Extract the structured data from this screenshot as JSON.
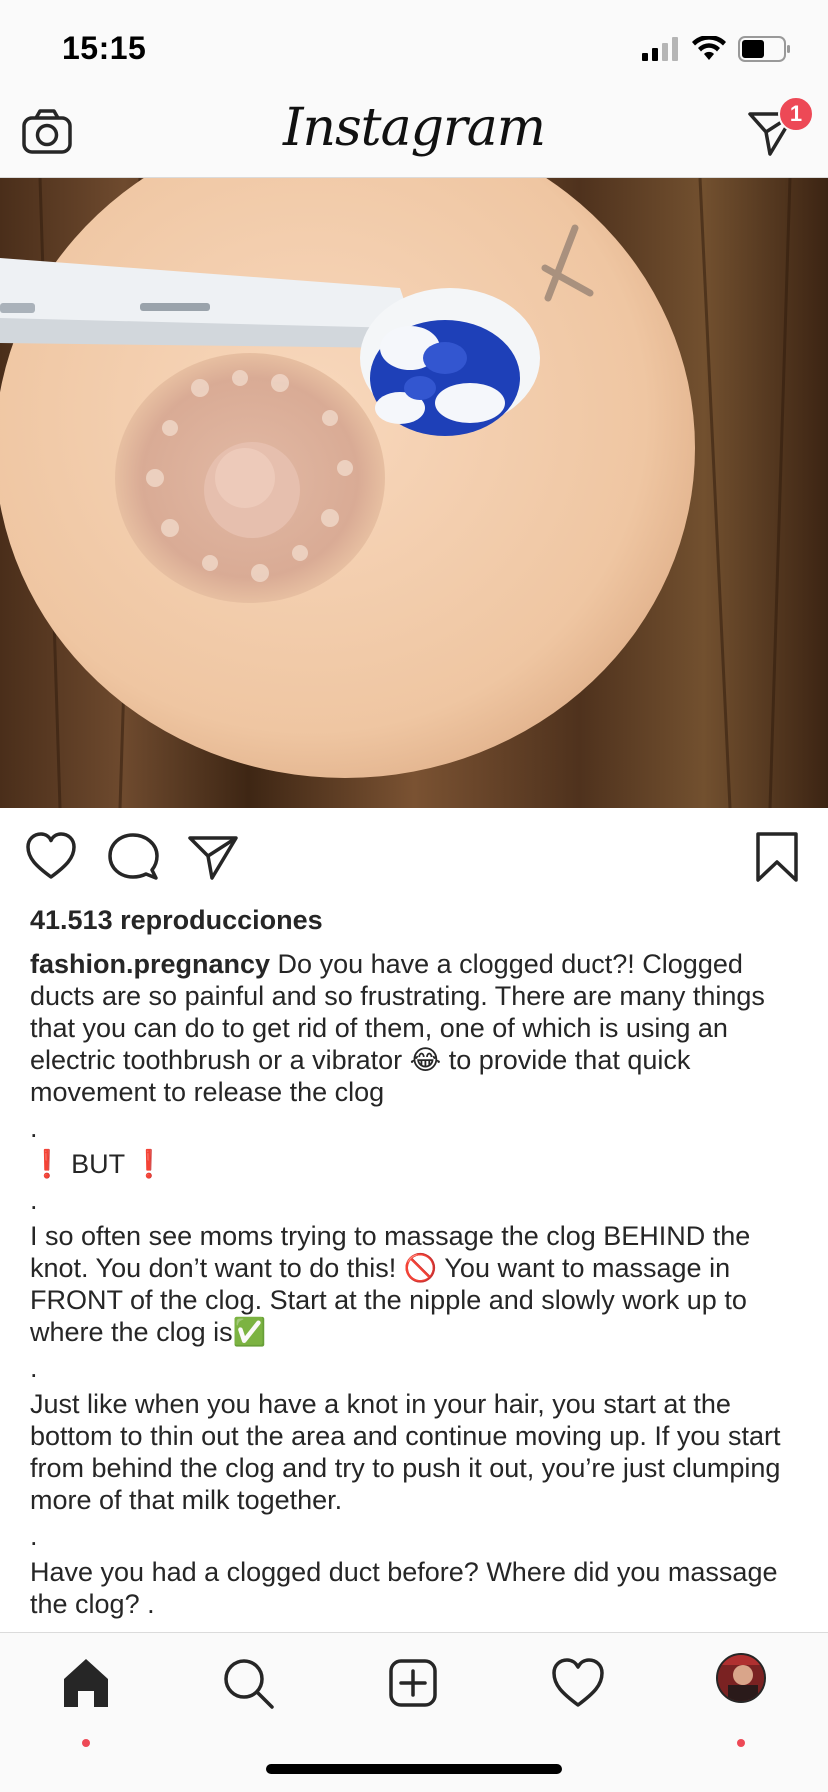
{
  "status_bar": {
    "time": "15:15"
  },
  "header": {
    "logo": "Instagram",
    "notification_count": "1"
  },
  "post": {
    "views": "41.513 reproducciones",
    "username": "fashion.pregnancy",
    "caption": {
      "line1": " Do you have a clogged duct?! Clogged ducts are so painful and so frustrating. There are many things that you can do to get rid of them, one of which is using an electric toothbrush or a vibrator 😂 to provide that quick movement to release the clog",
      "dot1": ".",
      "but": "❗ BUT ❗",
      "dot2": ".",
      "para2": "I so often see moms trying to massage the clog BEHIND the knot. You don’t want to do this! 🚫 You want to massage in FRONT of the clog. Start at the nipple and slowly work up to where the clog is✅",
      "dot3": ".",
      "para3": "Just like when you have a knot in your hair, you start at the bottom to thin out the area and continue moving up. If you start from behind the clog and try to push it out, you’re just clumping more of that milk together.",
      "dot4": ".",
      "para4": "Have you had a clogged duct before? Where did you massage the clog? ."
    }
  },
  "tabs": [
    "home-tab",
    "search-tab",
    "create-tab",
    "activity-tab",
    "profile-tab"
  ],
  "colors": {
    "accent": "#ed4956",
    "text": "#262626",
    "bar_bg": "#fafafa",
    "divider": "#dbdbdb"
  }
}
